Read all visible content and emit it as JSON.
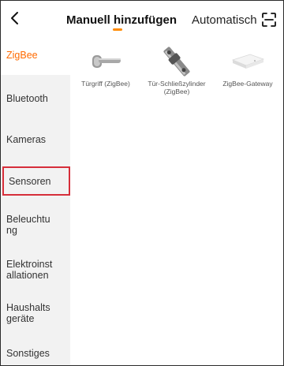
{
  "header": {
    "tab_manual": "Manuell hinzufügen",
    "tab_auto": "Automatisch",
    "accent_color": "#ff8a00",
    "back_icon": "chevron-left-icon",
    "scan_icon": "scan-icon"
  },
  "sidebar": {
    "items": [
      {
        "label": "ZigBee"
      },
      {
        "label": "Bluetooth"
      },
      {
        "label": "Kameras"
      },
      {
        "label": "Sensoren"
      },
      {
        "label": "Beleuchtu ng"
      },
      {
        "label": "Elektroinst allationen"
      },
      {
        "label": "Haushalts geräte"
      },
      {
        "label": "Sonstiges"
      }
    ],
    "active_index": 0,
    "highlighted_index": 3,
    "active_color": "#ff6a00",
    "highlight_color": "#d62e3a"
  },
  "devices": [
    {
      "label": "Türgriff (ZigBee)",
      "icon": "door-handle-icon"
    },
    {
      "label": "Tür-Schließzylinder (ZigBee)",
      "icon": "lock-cylinder-icon"
    },
    {
      "label": "ZigBee-Gateway",
      "icon": "gateway-icon"
    }
  ]
}
